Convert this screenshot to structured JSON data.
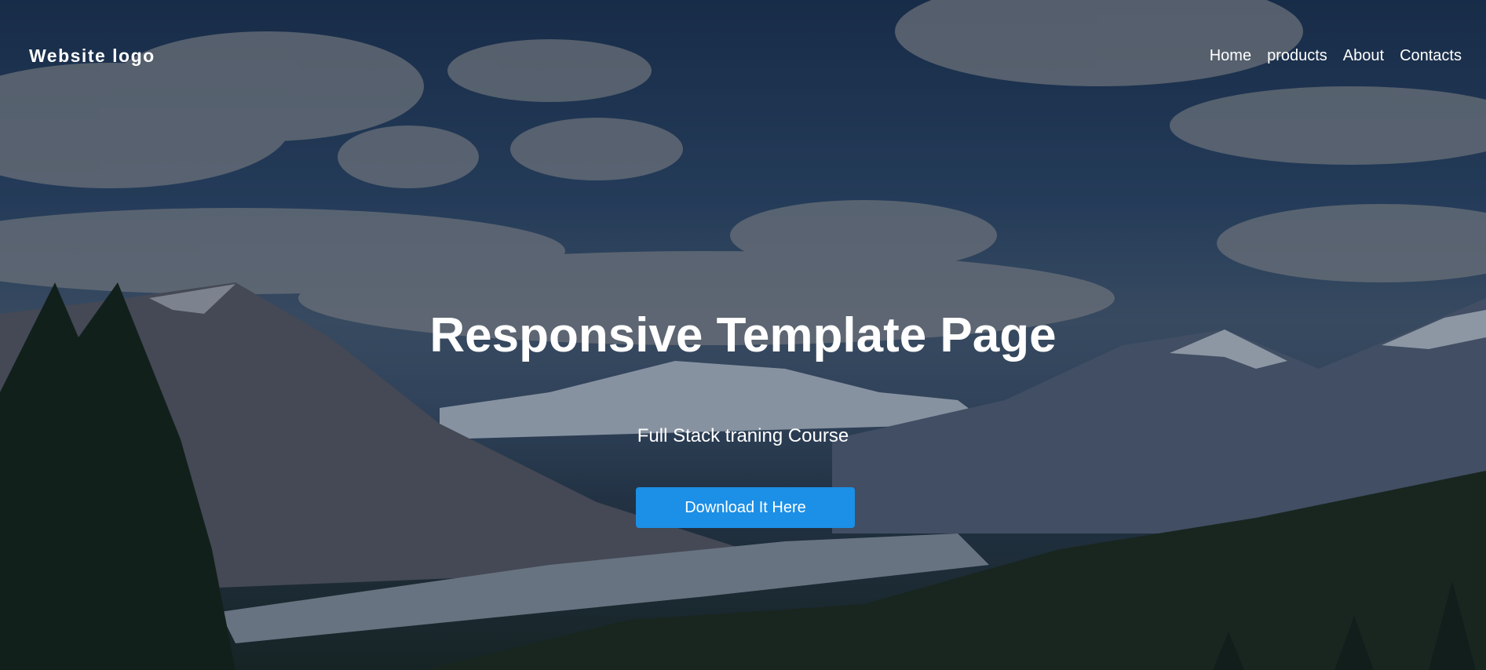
{
  "header": {
    "logo_text": "Website logo",
    "nav": [
      {
        "label": "Home"
      },
      {
        "label": "products"
      },
      {
        "label": "About"
      },
      {
        "label": "Contacts"
      }
    ]
  },
  "hero": {
    "title": "Responsive Template Page",
    "subtitle": "Full Stack traning Course",
    "cta_label": "Download It Here"
  },
  "colors": {
    "accent": "#1c8fe6",
    "text": "#ffffff"
  }
}
